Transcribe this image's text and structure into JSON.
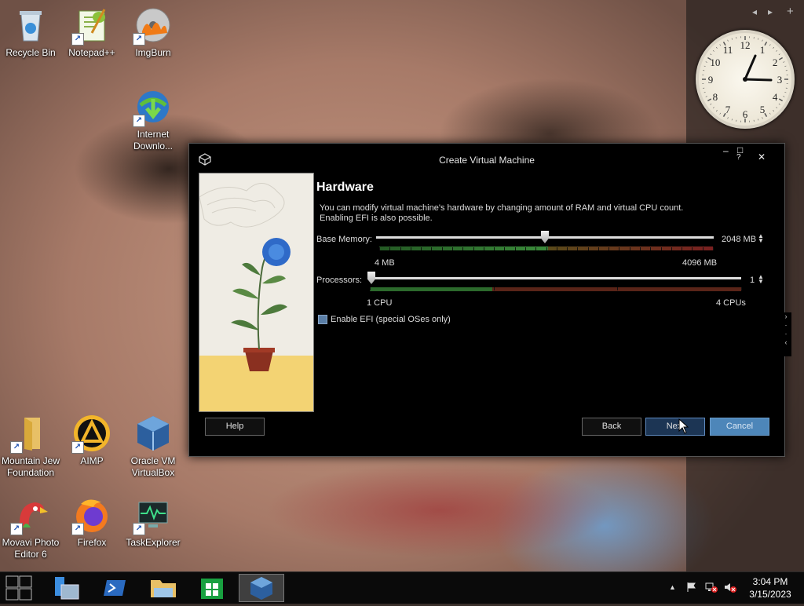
{
  "desktop": {
    "icons": [
      {
        "label": "Recycle Bin"
      },
      {
        "label": "Notepad++"
      },
      {
        "label": "ImgBurn"
      },
      {
        "label": "Internet Downlo..."
      },
      {
        "label": "Mountain Jew Foundation"
      },
      {
        "label": "AIMP"
      },
      {
        "label": "Oracle VM VirtualBox"
      },
      {
        "label": "Movavi Photo Editor 6"
      },
      {
        "label": "Firefox"
      },
      {
        "label": "TaskExplorer"
      }
    ]
  },
  "gadget_strip": {
    "prev": "◂",
    "next": "▸",
    "add": "+"
  },
  "clock_gadget": {
    "numbers": [
      "12",
      "1",
      "2",
      "3",
      "4",
      "5",
      "6",
      "7",
      "8",
      "9",
      "10",
      "11"
    ],
    "time": "3:04"
  },
  "dialog": {
    "title": "Create Virtual Machine",
    "controls": {
      "minimize": "‒",
      "maximize": "□",
      "help": "?",
      "close": "✕"
    },
    "heading": "Hardware",
    "description": "You can modify virtual machine's hardware by changing amount of RAM and virtual CPU count. Enabling EFI is also possible.",
    "base_memory": {
      "label": "Base Memory:",
      "value": "2048 MB",
      "min_label": "4 MB",
      "max_label": "4096 MB",
      "position": 0.5
    },
    "processors": {
      "label": "Processors:",
      "value": "1",
      "min_label": "1 CPU",
      "max_label": "4 CPUs",
      "position": 0.0
    },
    "efi": {
      "label": "Enable EFI (special OSes only)",
      "checked": false
    },
    "buttons": {
      "help": "Help",
      "back": "Back",
      "next": "Next",
      "cancel": "Cancel"
    }
  },
  "taskbar": {
    "time": "3:04 PM",
    "date": "3/15/2023",
    "tray": {
      "overflow": "▲"
    }
  },
  "colors": {
    "dialog_bg": "#000000",
    "next_button": "#1c3554",
    "cancel_button": "#4d86b9",
    "scale_green": "#2f6b2f",
    "scale_red": "#6b1f1f"
  }
}
